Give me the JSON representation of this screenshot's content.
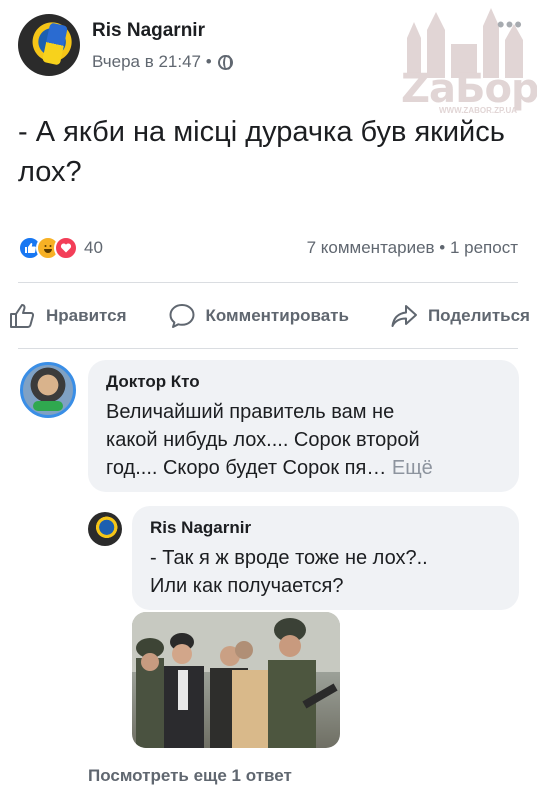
{
  "post": {
    "author": "Ris Nagarnir",
    "time": "Вчера в 21:47 •",
    "text": "- А якби на місці дурачка був якийсь лох?",
    "reactions_count": "40",
    "comments_shares": "7 комментариев • 1 репост"
  },
  "watermark": {
    "name": "ZaБор",
    "url": "WWW.ZABOR.ZP.UA"
  },
  "actions": {
    "like": "Нравится",
    "comment": "Комментировать",
    "share": "Поделиться"
  },
  "comments": [
    {
      "author": "Доктор Кто",
      "text_lines": [
        "Величайший правитель вам не",
        "какой нибудь лох.... Сорок второй",
        "год.... Скоро будет Сорок пя… "
      ],
      "more": "Ещё"
    }
  ],
  "reply": {
    "author": "Ris Nagarnir",
    "text_lines": [
      "- Так я ж вроде тоже не лох?..",
      "Или как получается?"
    ]
  },
  "view_more_replies": "Посмотреть еще 1 ответ",
  "colors": {
    "accent_like": "#1877f2",
    "haha": "#f7b125",
    "love": "#f33e58",
    "muted": "#606770",
    "bubble": "#f0f2f5"
  }
}
